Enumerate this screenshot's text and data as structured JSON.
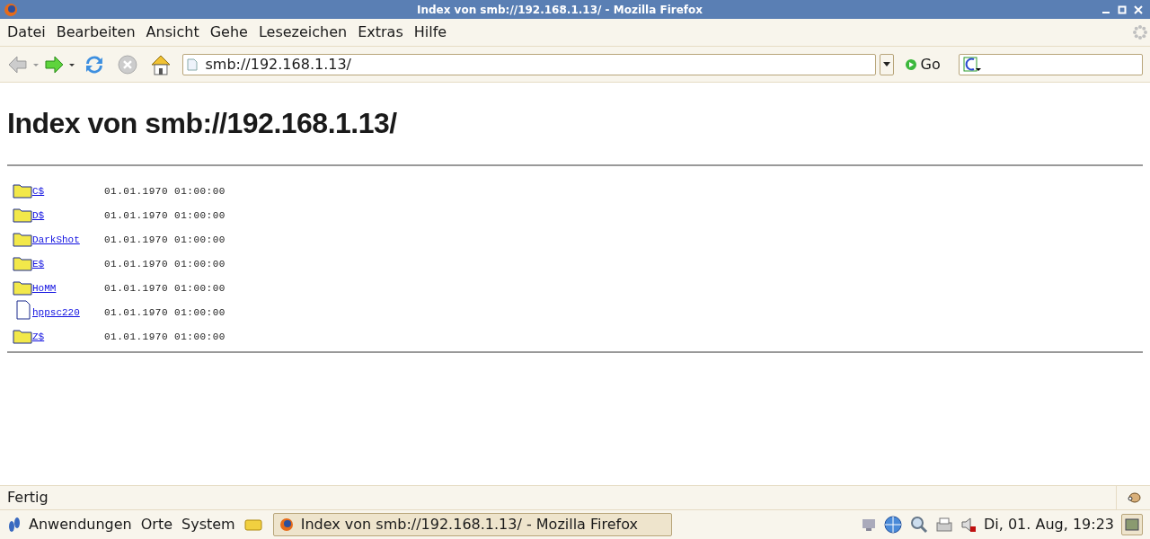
{
  "window": {
    "title": "Index von smb://192.168.1.13/ - Mozilla Firefox"
  },
  "menu": [
    "Datei",
    "Bearbeiten",
    "Ansicht",
    "Gehe",
    "Lesezeichen",
    "Extras",
    "Hilfe"
  ],
  "toolbar": {
    "url": "smb://192.168.1.13/",
    "go": "Go"
  },
  "page": {
    "heading": "Index von smb://192.168.1.13/",
    "entries": [
      {
        "kind": "folder",
        "name": "C$",
        "date": "01.01.1970 01:00:00"
      },
      {
        "kind": "folder",
        "name": "D$",
        "date": "01.01.1970 01:00:00"
      },
      {
        "kind": "folder",
        "name": "DarkShot",
        "date": "01.01.1970 01:00:00"
      },
      {
        "kind": "folder",
        "name": "E$",
        "date": "01.01.1970 01:00:00"
      },
      {
        "kind": "folder",
        "name": "HoMM",
        "date": "01.01.1970 01:00:00"
      },
      {
        "kind": "file",
        "name": "hppsc220",
        "date": "01.01.1970 01:00:00"
      },
      {
        "kind": "folder",
        "name": "Z$",
        "date": "01.01.1970 01:00:00"
      }
    ]
  },
  "status_bar": {
    "text": "Fertig"
  },
  "taskbar": {
    "menus": [
      "Anwendungen",
      "Orte",
      "System"
    ],
    "task": "Index von smb://192.168.1.13/ - Mozilla Firefox",
    "clock": "Di, 01. Aug, 19:23"
  }
}
